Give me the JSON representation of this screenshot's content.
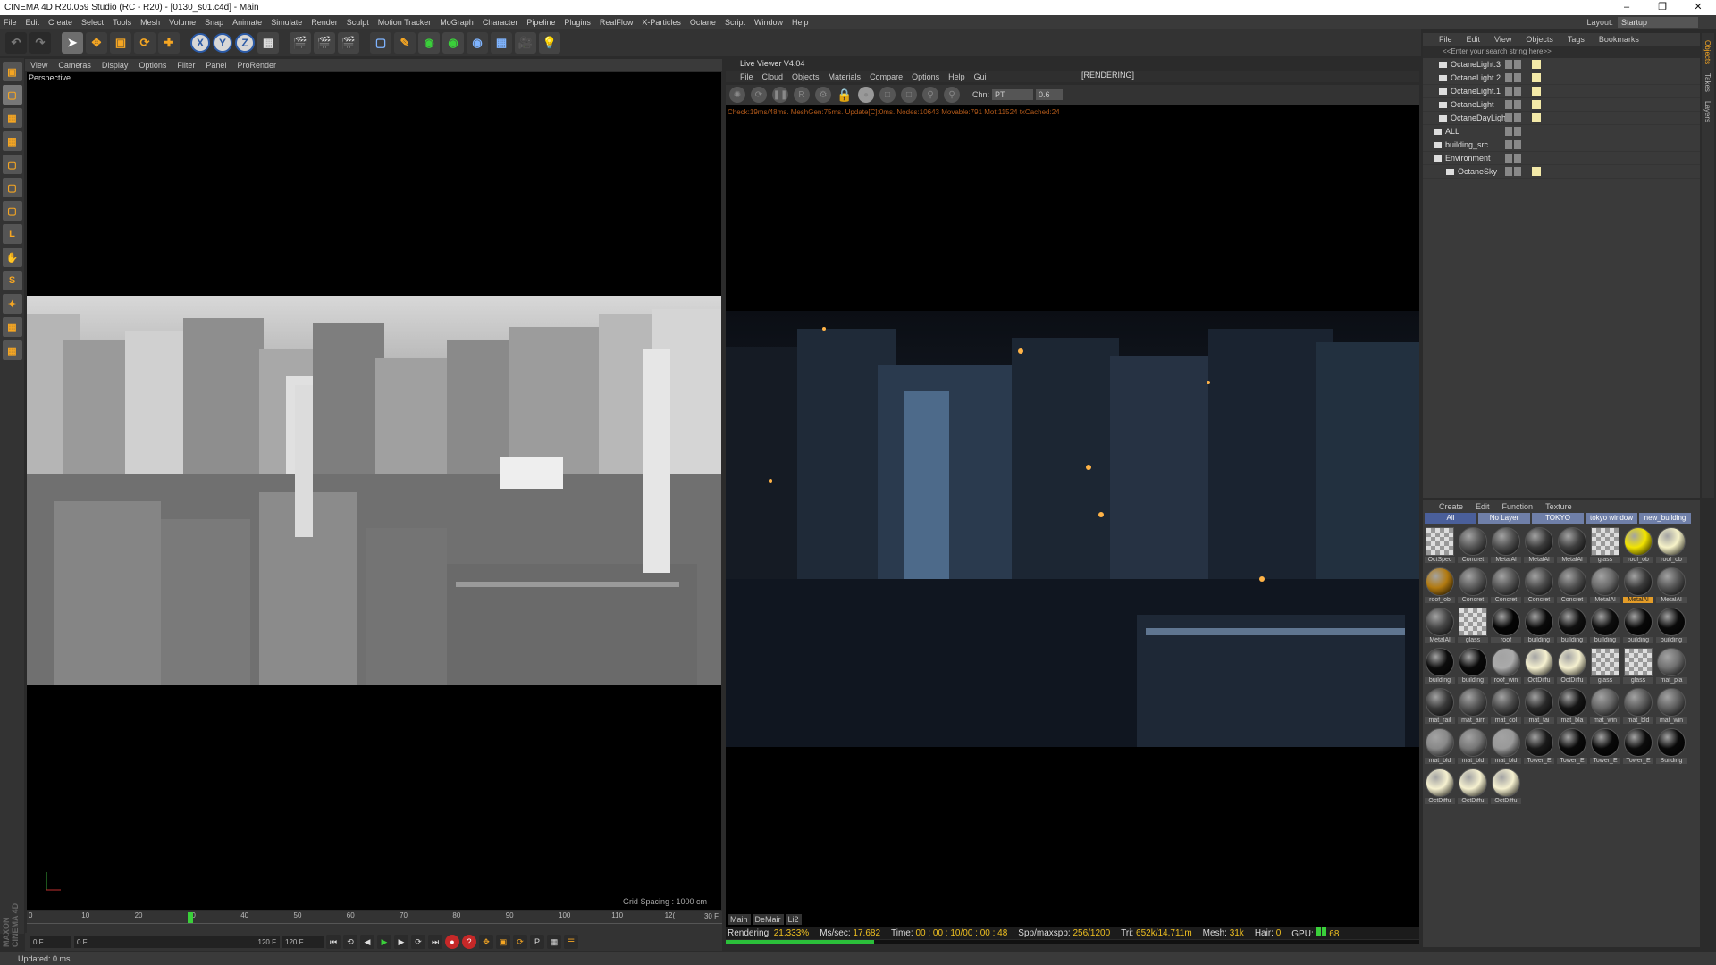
{
  "window": {
    "title": "CINEMA 4D R20.059 Studio (RC - R20) - [0130_s01.c4d] - Main",
    "controls": [
      "–",
      "❐",
      "✕"
    ]
  },
  "menu": [
    "File",
    "Edit",
    "Create",
    "Select",
    "Tools",
    "Mesh",
    "Volume",
    "Snap",
    "Animate",
    "Simulate",
    "Render",
    "Sculpt",
    "Motion Tracker",
    "MoGraph",
    "Character",
    "Pipeline",
    "Plugins",
    "RealFlow",
    "X-Particles",
    "Octane",
    "Script",
    "Window",
    "Help"
  ],
  "layout": {
    "label": "Layout:",
    "value": "Startup"
  },
  "toolbar": {
    "x": "X",
    "y": "Y",
    "z": "Z"
  },
  "viewport": {
    "menu": [
      "View",
      "Cameras",
      "Display",
      "Options",
      "Filter",
      "Panel",
      "ProRender"
    ],
    "label": "Perspective",
    "grid": "Grid Spacing : 1000 cm"
  },
  "timeline": {
    "ticks": [
      "0",
      "10",
      "20",
      "30",
      "40",
      "50",
      "60",
      "70",
      "80",
      "90",
      "100",
      "110",
      "12("
    ],
    "end": "30 F",
    "current_frame": 30
  },
  "transport": {
    "start": "0 F",
    "min": "0 F",
    "max": "120 F",
    "end": "120 F"
  },
  "status": "Updated: 0 ms.",
  "maxon": "MAXON CINEMA 4D",
  "liveviewer": {
    "title": "Live Viewer V4.04",
    "menu": [
      "File",
      "Cloud",
      "Objects",
      "Materials",
      "Compare",
      "Options",
      "Help",
      "Gui"
    ],
    "state": "[RENDERING]",
    "chn_label": "Chn:",
    "chn_value": "PT",
    "chn_num": "0.6",
    "info": "Check:19ms/48ms. MeshGen:75ms. Update[C]:0ms. Nodes:10643 Movable:791 Mot:11524 txCached:24",
    "tabs": [
      "Main",
      "DeMair",
      "Li2"
    ],
    "stats": {
      "rendering_label": "Rendering:",
      "rendering": "21.333%",
      "ms_label": "Ms/sec:",
      "ms": "17.682",
      "time_label": "Time:",
      "time": "00 : 00 : 10/00 : 00 : 48",
      "spp_label": "Spp/maxspp:",
      "spp": "256/1200",
      "tri_label": "Tri:",
      "tri": "652k/14.711m",
      "mesh_label": "Mesh:",
      "mesh": "31k",
      "hair_label": "Hair:",
      "hair": "0",
      "gpu_label": "GPU:",
      "gpu": "68"
    },
    "progress": 21.333
  },
  "objects": {
    "menu": [
      "File",
      "Edit",
      "View",
      "Objects",
      "Tags",
      "Bookmarks"
    ],
    "search": "<<Enter your search string here>>",
    "rows": [
      {
        "name": "OctaneLight.3",
        "ind": 6
      },
      {
        "name": "OctaneLight.2",
        "ind": 6
      },
      {
        "name": "OctaneLight.1",
        "ind": 6
      },
      {
        "name": "OctaneLight",
        "ind": 6
      },
      {
        "name": "OctaneDayLight",
        "ind": 6
      },
      {
        "name": "ALL",
        "ind": 0
      },
      {
        "name": "building_src",
        "ind": 0
      },
      {
        "name": "Environment",
        "ind": 0
      },
      {
        "name": "OctaneSky",
        "ind": 14
      }
    ]
  },
  "sidetabs": [
    "Objects",
    "Takes",
    "Layers"
  ],
  "materials": {
    "menu": [
      "Create",
      "Edit",
      "Function",
      "Texture"
    ],
    "tabs": [
      "All",
      "No Layer",
      "TOKYO",
      "tokyo window",
      "new_building"
    ],
    "items": [
      {
        "n": "OctSpec",
        "c": "#6a6a6a",
        "t": "checker"
      },
      {
        "n": "Concret",
        "c": "#555"
      },
      {
        "n": "MetalAl",
        "c": "#4e4e4e"
      },
      {
        "n": "MetalAl",
        "c": "#3a3a3a"
      },
      {
        "n": "MetalAl",
        "c": "#3f3f3f"
      },
      {
        "n": "glass",
        "c": "#777",
        "t": "checker"
      },
      {
        "n": "roof_ob",
        "c": "#f2e400"
      },
      {
        "n": "roof_ob",
        "c": "#f7f3c8"
      },
      {
        "n": "roof_ob",
        "c": "#b27a10"
      },
      {
        "n": "Concret",
        "c": "#5a5a5a"
      },
      {
        "n": "Concret",
        "c": "#555"
      },
      {
        "n": "Concret",
        "c": "#4a4a4a"
      },
      {
        "n": "Concret",
        "c": "#505050"
      },
      {
        "n": "MetalAl",
        "c": "#6a6a6a"
      },
      {
        "n": "MetalAl",
        "c": "#3a3a3a",
        "hl": true
      },
      {
        "n": "MetalAl",
        "c": "#555"
      },
      {
        "n": "MetalAl",
        "c": "#454545"
      },
      {
        "n": "glass",
        "c": "#777",
        "t": "checker"
      },
      {
        "n": "roof",
        "c": "#050505"
      },
      {
        "n": "building",
        "c": "#0a0a0a"
      },
      {
        "n": "building",
        "c": "#101010"
      },
      {
        "n": "building",
        "c": "#0d0d0d"
      },
      {
        "n": "building",
        "c": "#080808"
      },
      {
        "n": "building",
        "c": "#0a0a0a"
      },
      {
        "n": "building",
        "c": "#0c0c0c"
      },
      {
        "n": "building",
        "c": "#090909"
      },
      {
        "n": "roof_win",
        "c": "#aaa"
      },
      {
        "n": "OctDiffu",
        "c": "#f6f1d0"
      },
      {
        "n": "OctDiffu",
        "c": "#f6f1d0"
      },
      {
        "n": "glass",
        "c": "#777",
        "t": "checker"
      },
      {
        "n": "glass",
        "c": "#777",
        "t": "checker"
      },
      {
        "n": "mat_pla",
        "c": "#707070"
      },
      {
        "n": "mat_rail",
        "c": "#3a3a3a"
      },
      {
        "n": "mat_airr",
        "c": "#555"
      },
      {
        "n": "mat_col",
        "c": "#4a4a4a"
      },
      {
        "n": "mat_tai",
        "c": "#2a2a2a"
      },
      {
        "n": "mat_bla",
        "c": "#151515"
      },
      {
        "n": "mat_win",
        "c": "#666"
      },
      {
        "n": "mat_bld",
        "c": "#5a5a5a"
      },
      {
        "n": "mat_win",
        "c": "#606060"
      },
      {
        "n": "mat_bld",
        "c": "#888"
      },
      {
        "n": "mat_bld",
        "c": "#777"
      },
      {
        "n": "mat_bld",
        "c": "#999"
      },
      {
        "n": "Tower_E",
        "c": "#1a1a1a"
      },
      {
        "n": "Tower_E",
        "c": "#0a0a0a"
      },
      {
        "n": "Tower_E",
        "c": "#080808"
      },
      {
        "n": "Tower_E",
        "c": "#0c0c0c"
      },
      {
        "n": "Building",
        "c": "#090909"
      },
      {
        "n": "OctDiffu",
        "c": "#f6f1d0"
      },
      {
        "n": "OctDiffu",
        "c": "#f6f1d0"
      },
      {
        "n": "OctDiffu",
        "c": "#f6f1d0"
      }
    ]
  }
}
